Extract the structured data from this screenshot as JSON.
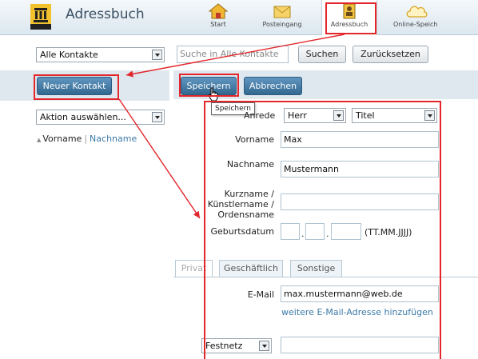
{
  "header": {
    "app_title": "Adressbuch",
    "nav": [
      {
        "label": "Start",
        "icon": "home-icon"
      },
      {
        "label": "Posteingang",
        "icon": "envelope-icon"
      },
      {
        "label": "Adressbuch",
        "icon": "address-book-icon",
        "active": true
      },
      {
        "label": "Online-Speich",
        "icon": "cloud-icon"
      }
    ]
  },
  "toolbar": {
    "contact_filter": "Alle Kontakte",
    "search_placeholder": "Suche in Alle Kontakte",
    "search_button": "Suchen",
    "reset_button": "Zurücksetzen"
  },
  "left": {
    "new_contact_button": "Neuer Kontakt",
    "action_select": "Aktion auswählen...",
    "sort_first": "Vorname",
    "sort_separator": "|",
    "sort_last": "Nachname"
  },
  "right": {
    "save_button": "Speichern",
    "cancel_button": "Abbrechen",
    "tooltip": "Speichern"
  },
  "form": {
    "salutation_label": "Anrede",
    "salutation_value": "Herr",
    "title_value": "Titel",
    "firstname_label": "Vorname",
    "firstname_value": "Max",
    "lastname_label": "Nachname",
    "lastname_value": "Mustermann",
    "nickname_label_1": "Kurzname /",
    "nickname_label_2": "Künstlername /",
    "nickname_label_3": "Ordensname",
    "nickname_value": "",
    "birthday_label": "Geburtsdatum",
    "birthday_day": "",
    "birthday_month": "",
    "birthday_year": "",
    "birthday_dot": ".",
    "birthday_format": "(TT.MM.JJJJ)"
  },
  "tabs": [
    {
      "label": "Privat",
      "active": true
    },
    {
      "label": "Geschäftlich"
    },
    {
      "label": "Sonstige"
    }
  ],
  "contact": {
    "email_label": "E-Mail",
    "email_value": "max.mustermann@web.de",
    "add_email_link": "weitere E-Mail-Adresse hinzufügen",
    "phone_type": "Festnetz",
    "phone_value": ""
  },
  "colors": {
    "accent_blue": "#33698f",
    "annotation_red": "#e3262b",
    "toolbar_bg": "#dfe8ef",
    "link_blue": "#3b7aa8"
  }
}
